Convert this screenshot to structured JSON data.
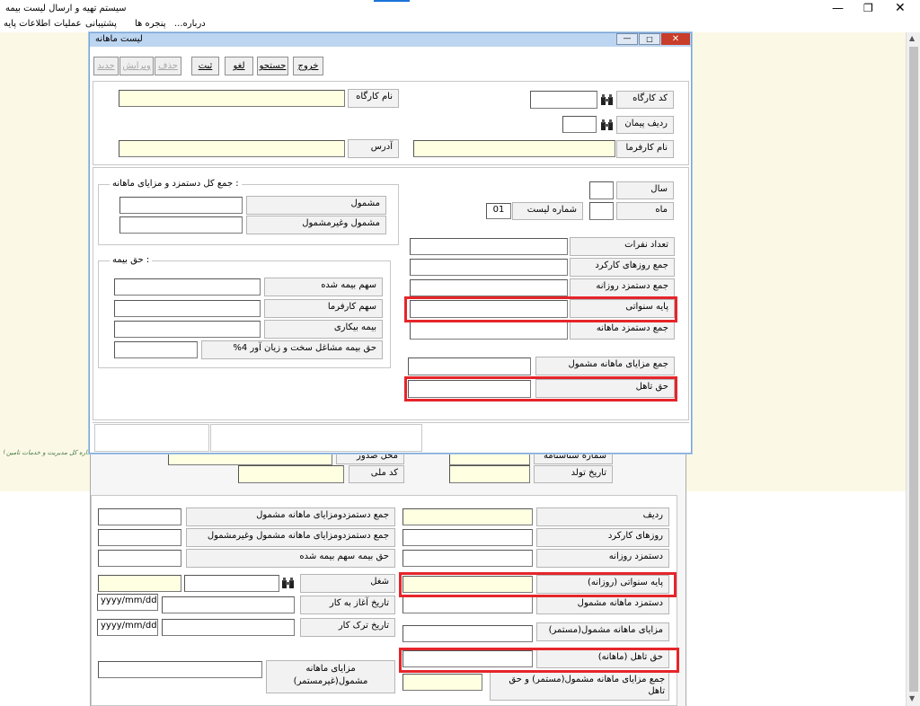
{
  "app": {
    "title": "سیستم تهیه و ارسال لیست بیمه",
    "menu": [
      "...درباره",
      "پنجره ها",
      "پشتیبانی",
      "عملیات",
      "اطلاعات پایه"
    ],
    "logo_text": "اداره کل مدیریت و خدمات تامین اجتماعی"
  },
  "dialog": {
    "title": "لیست ماهانه",
    "toolbar": {
      "exit": "خروج",
      "search": "جستجو",
      "cancel": "لغو",
      "save": "ثبت",
      "delete": "حذف",
      "edit": "ویرایش",
      "new": "جدید"
    },
    "workshop": {
      "code_label": "کد کارگاه",
      "code_value": "",
      "name_label": "نام کارگاه",
      "name_value": "",
      "contract_label": "ردیف پیمان",
      "contract_value": "",
      "address_label": "آدرس",
      "address_value": "",
      "employer_label": "نام کارفرما",
      "employer_value": ""
    },
    "period": {
      "year_label": "سال",
      "year_value": "",
      "month_label": "ماه",
      "month_value": "",
      "list_no_label": "شماره لیست",
      "list_no_value": "01"
    },
    "totals": {
      "headcount": "تعداد نفرات",
      "work_days": "جمع روزهای کارکرد",
      "daily_wage": "جمع دستمزد روزانه",
      "seniority": "پایه سنواتی",
      "monthly_wage": "جمع دستمزد ماهانه",
      "benefits": "جمع مزایای ماهانه مشمول",
      "marital": "حق تاهل"
    },
    "wage_group": {
      "title": ": جمع کل دستمزد و مزایای ماهانه",
      "taxable": "مشمول",
      "taxable_non": "مشمول وغیرمشمول"
    },
    "insurance_group": {
      "title": ": حق بیمه",
      "insured_share": "سهم بیمه شده",
      "employer_share": "سهم کارفرما",
      "unemployment": "بیمه بیکاری",
      "hard_jobs": "حق بیمه مشاغل سخت و زیان آور 4%"
    }
  },
  "background_form": {
    "birth_place_label": "محل صدور",
    "id_no_label": "شماره شناسنامه",
    "national_code_label": "کد ملی",
    "birth_date_label": "تاریخ تولد"
  },
  "detail": {
    "row": "ردیف",
    "work_days": "روزهای کارکرد",
    "daily_wage": "دستمزد روزانه",
    "seniority_daily": "پایه سنواتی (روزانه)",
    "monthly_wage": "دستمزد ماهانه مشمول",
    "monthly_benefits_cont": "مزایای ماهانه مشمول(مستمر)",
    "marital_monthly": "حق تاهل (ماهانه)",
    "total_benefits_marital": "جمع مزایای ماهانه مشمول(مستمر) و حق تاهل",
    "sum_wage_taxable": "جمع دستمزدومزایای ماهانه مشمول",
    "sum_wage_all": "جمع دستمزدومزایای ماهانه مشمول وغیرمشمول",
    "insured_share": "حق بیمه سهم بیمه شده",
    "job": "شغل",
    "start_date": "تاریخ آغاز به کار",
    "end_date": "تاریخ ترک کار",
    "date_format": "yyyy/mm/dd",
    "benefits_noncont": "مزایای ماهانه مشمول(غیرمستمر)"
  },
  "colors": {
    "highlight": "#e5252a",
    "yellow_field": "#ffffe1",
    "close_button": "#c83c2a",
    "window_bg": "#fcf8e6"
  }
}
